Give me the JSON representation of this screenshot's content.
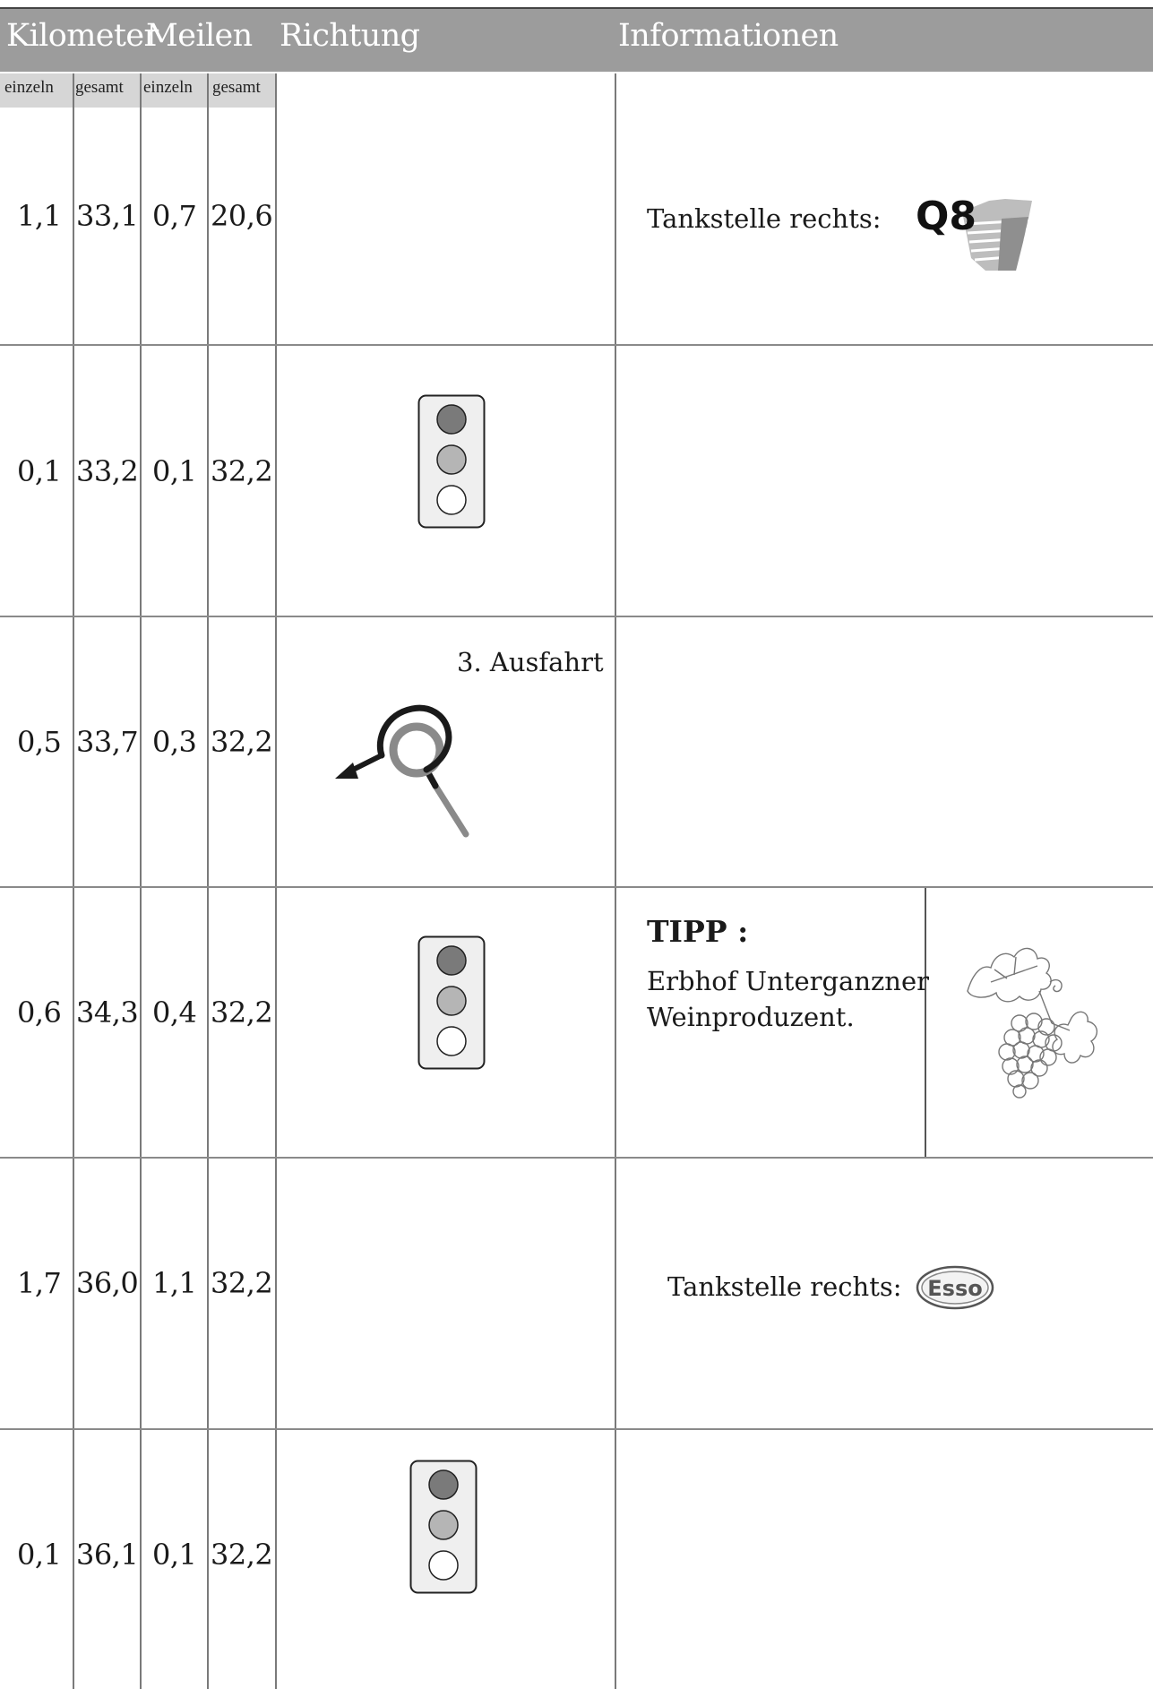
{
  "header": {
    "col_kilometer": "Kilometer",
    "col_meilen": "Meilen",
    "col_richtung": "Richtung",
    "col_informationen": "Informationen",
    "sub": [
      "einzeln",
      "gesamt",
      "einzeln",
      "gesamt"
    ]
  },
  "rows": [
    {
      "km_einzeln": "1,1",
      "km_gesamt": "33,1",
      "mi_einzeln": "0,7",
      "mi_gesamt": "20,6",
      "direction_icon": "",
      "direction_text": "",
      "info": "Tankstelle rechts:",
      "info_icon": "q8-logo"
    },
    {
      "km_einzeln": "0,1",
      "km_gesamt": "33,2",
      "mi_einzeln": "0,1",
      "mi_gesamt": "32,2",
      "direction_icon": "traffic-light-icon",
      "direction_text": "",
      "info": "",
      "info_icon": ""
    },
    {
      "km_einzeln": "0,5",
      "km_gesamt": "33,7",
      "mi_einzeln": "0,3",
      "mi_gesamt": "32,2",
      "direction_icon": "roundabout-icon",
      "direction_text": "3. Ausfahrt",
      "info": "",
      "info_icon": ""
    },
    {
      "km_einzeln": "0,6",
      "km_gesamt": "34,3",
      "mi_einzeln": "0,4",
      "mi_gesamt": "32,2",
      "direction_icon": "traffic-light-icon",
      "direction_text": "",
      "tipp_title": "TIPP :",
      "tipp_line1": "Erbhof Unterganzner",
      "tipp_line2": "Weinproduzent.",
      "info_icon": "grape-icon"
    },
    {
      "km_einzeln": "1,7",
      "km_gesamt": "36,0",
      "mi_einzeln": "1,1",
      "mi_gesamt": "32,2",
      "direction_icon": "",
      "direction_text": "",
      "info": "Tankstelle rechts:",
      "info_icon": "esso-logo"
    },
    {
      "km_einzeln": "0,1",
      "km_gesamt": "36,1",
      "mi_einzeln": "0,1",
      "mi_gesamt": "32,2",
      "direction_icon": "traffic-light-icon",
      "direction_text": "",
      "info": "",
      "info_icon": ""
    }
  ],
  "logos": {
    "q8": "Q8",
    "esso": "Esso"
  },
  "colors": {
    "header_bg": "#9c9c9c",
    "subheader_bg": "#d6d6d6",
    "grid": "#7a7a7a"
  }
}
